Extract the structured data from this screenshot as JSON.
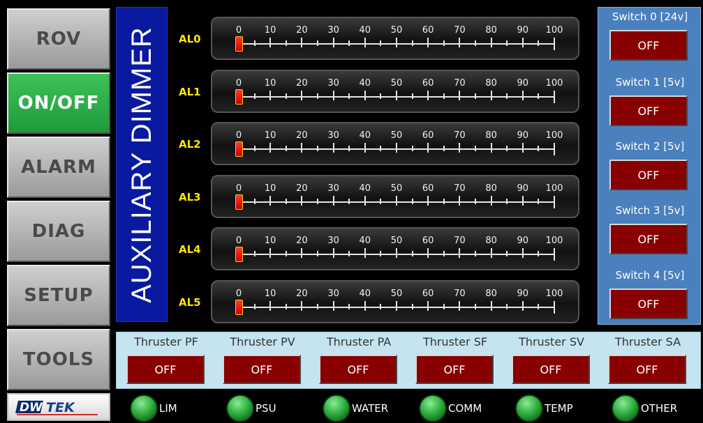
{
  "nav": {
    "items": [
      {
        "label": "ROV"
      },
      {
        "label": "ON/OFF",
        "active": true
      },
      {
        "label": "ALARM"
      },
      {
        "label": "DIAG"
      },
      {
        "label": "SETUP"
      },
      {
        "label": "TOOLS"
      }
    ],
    "logo_text": "DWTEK"
  },
  "title": "AUXILIARY DIMMER",
  "dimmers": [
    {
      "label": "AL0",
      "value": 0
    },
    {
      "label": "AL1",
      "value": 0
    },
    {
      "label": "AL2",
      "value": 0
    },
    {
      "label": "AL3",
      "value": 0
    },
    {
      "label": "AL4",
      "value": 0
    },
    {
      "label": "AL5",
      "value": 0
    }
  ],
  "scale": [
    "0",
    "10",
    "20",
    "30",
    "40",
    "50",
    "60",
    "70",
    "80",
    "90",
    "100"
  ],
  "switches": [
    {
      "label": "Switch 0 [24v]",
      "state": "OFF"
    },
    {
      "label": "Switch 1 [5v]",
      "state": "OFF"
    },
    {
      "label": "Switch 2 [5v]",
      "state": "OFF"
    },
    {
      "label": "Switch 3 [5v]",
      "state": "OFF"
    },
    {
      "label": "Switch 4 [5v]",
      "state": "OFF"
    }
  ],
  "thrusters": [
    {
      "label": "Thruster PF",
      "state": "OFF"
    },
    {
      "label": "Thruster PV",
      "state": "OFF"
    },
    {
      "label": "Thruster PA",
      "state": "OFF"
    },
    {
      "label": "Thruster SF",
      "state": "OFF"
    },
    {
      "label": "Thruster SV",
      "state": "OFF"
    },
    {
      "label": "Thruster SA",
      "state": "OFF"
    }
  ],
  "indicators": [
    {
      "label": "LIM",
      "status": "green"
    },
    {
      "label": "PSU",
      "status": "green"
    },
    {
      "label": "WATER",
      "status": "green"
    },
    {
      "label": "COMM",
      "status": "green"
    },
    {
      "label": "TEMP",
      "status": "green"
    },
    {
      "label": "OTHER",
      "status": "green"
    }
  ],
  "colors": {
    "active_nav": "#2fb24b",
    "title_bg": "#0a1aa0",
    "dimmer_label": "#ffe600",
    "switch_panel": "#4a80bd",
    "off_button": "#880000",
    "thruster_panel": "#c5e4ef",
    "led_green": "#2fb23e"
  }
}
